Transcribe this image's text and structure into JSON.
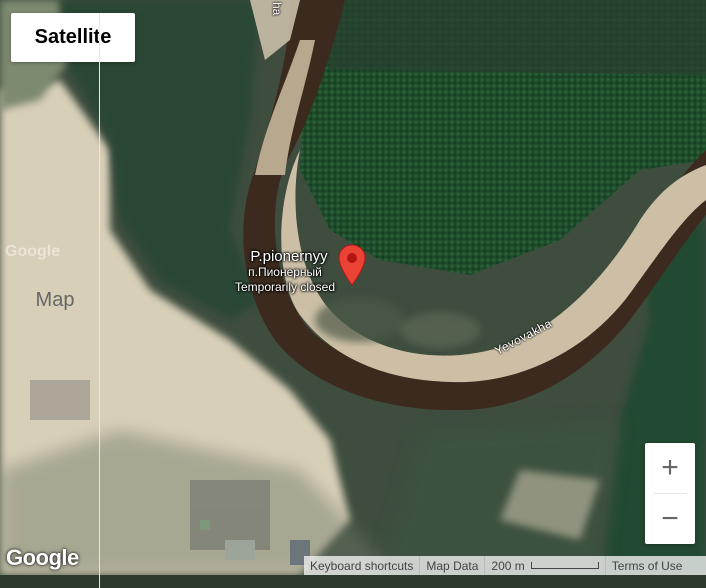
{
  "map_type_control": {
    "map_label": "Map",
    "satellite_label": "Satellite",
    "selected": "Satellite"
  },
  "place": {
    "name": "P.pionernyy",
    "local_name": "п.Пионерный",
    "status": "Temporarily closed"
  },
  "road_labels": {
    "river_label": "Yevovakha",
    "top_label": "ha"
  },
  "zoom": {
    "in_label": "+",
    "out_label": "−"
  },
  "branding": {
    "logo": "Google",
    "watermark": "Google"
  },
  "footer": {
    "keyboard_shortcuts": "Keyboard shortcuts",
    "map_data": "Map Data",
    "scale_label": "200 m",
    "terms": "Terms of Use"
  },
  "icons": {
    "marker": "map-pin-icon"
  },
  "colors": {
    "marker_red": "#ea4335",
    "water": "#3a2a1e",
    "forest": "#1f4a2b",
    "sand": "#d9d0bb"
  }
}
